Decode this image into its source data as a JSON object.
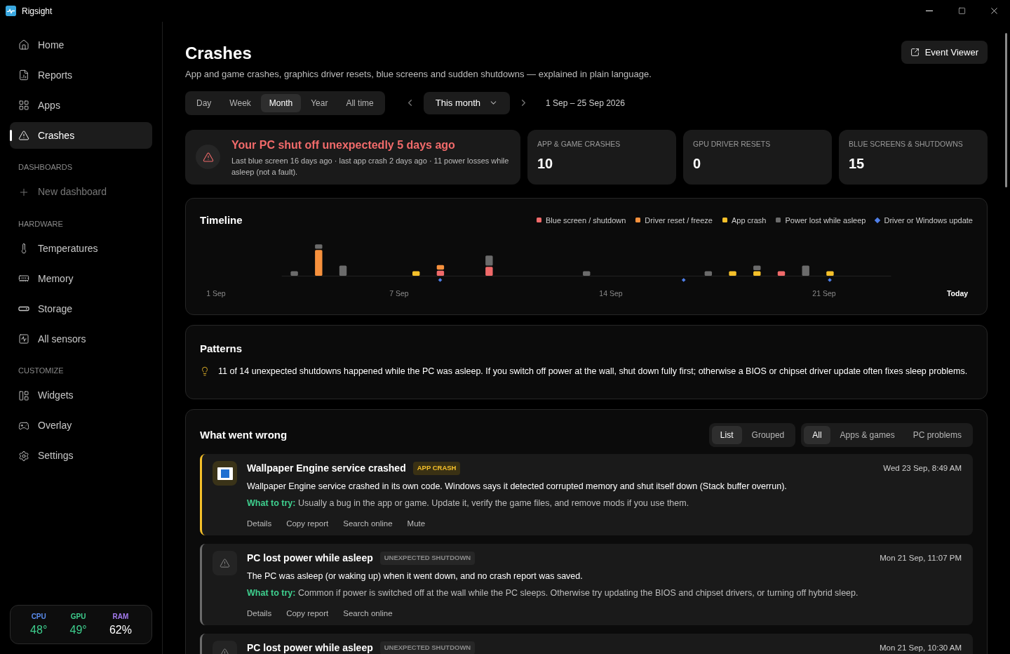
{
  "window": {
    "title": "Rigsight"
  },
  "sidebar": {
    "nav": [
      {
        "label": "Home",
        "selected": false
      },
      {
        "label": "Reports",
        "selected": false
      },
      {
        "label": "Apps",
        "selected": false
      },
      {
        "label": "Crashes",
        "selected": true
      }
    ],
    "sections": [
      {
        "heading": "DASHBOARDS",
        "items": [
          {
            "label": "New dashboard",
            "kind": "add"
          }
        ]
      },
      {
        "heading": "HARDWARE",
        "items": [
          {
            "label": "Temperatures",
            "kind": "link"
          },
          {
            "label": "Memory",
            "kind": "link"
          },
          {
            "label": "Storage",
            "kind": "link"
          },
          {
            "label": "All sensors",
            "kind": "link"
          }
        ]
      },
      {
        "heading": "CUSTOMIZE",
        "items": [
          {
            "label": "Widgets",
            "kind": "link"
          },
          {
            "label": "Overlay",
            "kind": "link"
          },
          {
            "label": "Settings",
            "kind": "link"
          }
        ]
      }
    ],
    "monitor": [
      {
        "label": "CPU",
        "value": "48°",
        "color": "#5b8def",
        "kind": "temp"
      },
      {
        "label": "GPU",
        "value": "49°",
        "color": "#3ecf8e",
        "kind": "temp"
      },
      {
        "label": "RAM",
        "value": "62%",
        "color": "#a57cf0",
        "kind": "percent"
      }
    ]
  },
  "page": {
    "title": "Crashes",
    "subtitle": "App and game crashes, graphics driver resets, blue screens and sudden shutdowns — explained in plain language.",
    "event_viewer_button": "Event Viewer",
    "range_tabs": [
      {
        "label": "Day",
        "selected": false
      },
      {
        "label": "Week",
        "selected": false
      },
      {
        "label": "Month",
        "selected": true
      },
      {
        "label": "Year",
        "selected": false
      },
      {
        "label": "All time",
        "selected": false
      }
    ],
    "period_dropdown": "This month",
    "date_range": "1 Sep – 25 Sep 2026"
  },
  "alert": {
    "title": "Your PC shut off unexpectedly 5 days ago",
    "detail": "Last blue screen 16 days ago · last app crash 2 days ago · 11 power losses while asleep (not a fault)."
  },
  "stats": [
    {
      "label": "APP & GAME CRASHES",
      "value": "10"
    },
    {
      "label": "GPU DRIVER RESETS",
      "value": "0"
    },
    {
      "label": "BLUE SCREENS & SHUTDOWNS",
      "value": "15"
    }
  ],
  "timeline": {
    "title": "Timeline",
    "legend": [
      {
        "label": "Blue screen / shutdown",
        "color": "#f06a6a",
        "kind": "square"
      },
      {
        "label": "Driver reset / freeze",
        "color": "#f7913d",
        "kind": "square"
      },
      {
        "label": "App crash",
        "color": "#f5c02a",
        "kind": "square"
      },
      {
        "label": "Power lost while asleep",
        "color": "#6b6b6b",
        "kind": "square"
      },
      {
        "label": "Driver or Windows update",
        "color": "#4f7fe8",
        "kind": "diamond"
      }
    ],
    "axis_labels": [
      {
        "label": "1 Sep",
        "kind": "date"
      },
      {
        "label": "7 Sep",
        "kind": "date"
      },
      {
        "label": "14 Sep",
        "kind": "date"
      },
      {
        "label": "21 Sep",
        "kind": "date"
      },
      {
        "label": "Today",
        "kind": "today"
      }
    ]
  },
  "patterns": {
    "title": "Patterns",
    "text": "11 of 14 unexpected shutdowns happened while the PC was asleep. If you switch off power at the wall, shut down fully first; otherwise a BIOS or chipset driver update often fixes sleep problems."
  },
  "events": {
    "title": "What went wrong",
    "view_tabs": [
      {
        "label": "List",
        "selected": true
      },
      {
        "label": "Grouped",
        "selected": false
      }
    ],
    "filter_tabs": [
      {
        "label": "All",
        "selected": true
      },
      {
        "label": "Apps & games",
        "selected": false
      },
      {
        "label": "PC problems",
        "selected": false
      }
    ],
    "items": [
      {
        "kind": "app_crash",
        "title": "Wallpaper Engine service crashed",
        "tag": "APP CRASH",
        "time": "Wed 23 Sep, 8:49 AM",
        "description": "Wallpaper Engine service crashed in its own code. Windows says it detected corrupted memory and shut itself down (Stack buffer overrun).",
        "tip_label": "What to try:",
        "tip": "Usually a bug in the app or game. Update it, verify the game files, and remove mods if you use them.",
        "actions": [
          "Details",
          "Copy report",
          "Search online",
          "Mute"
        ]
      },
      {
        "kind": "shutdown",
        "title": "PC lost power while asleep",
        "tag": "UNEXPECTED SHUTDOWN",
        "time": "Mon 21 Sep, 11:07 PM",
        "description": "The PC was asleep (or waking up) when it went down, and no crash report was saved.",
        "tip_label": "What to try:",
        "tip": "Common if power is switched off at the wall while the PC sleeps. Otherwise try updating the BIOS and chipset drivers, or turning off hybrid sleep.",
        "actions": [
          "Details",
          "Copy report",
          "Search online"
        ]
      },
      {
        "kind": "shutdown",
        "title": "PC lost power while asleep",
        "tag": "UNEXPECTED SHUTDOWN",
        "time": "Mon 21 Sep, 10:30 AM"
      }
    ]
  }
}
